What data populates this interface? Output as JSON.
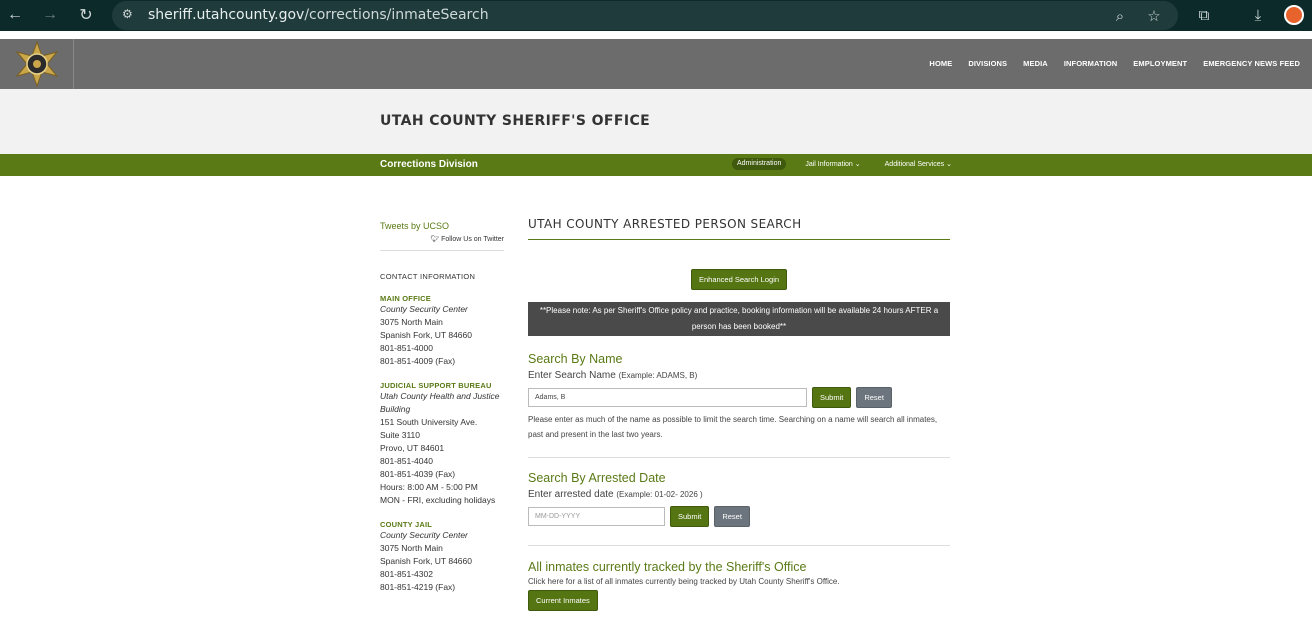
{
  "browser": {
    "url_domain": "sheriff.utahcounty.gov",
    "url_path": "/corrections/inmateSearch"
  },
  "header": {
    "nav": [
      "HOME",
      "DIVISIONS",
      "MEDIA",
      "INFORMATION",
      "EMPLOYMENT",
      "EMERGENCY NEWS FEED"
    ]
  },
  "banner": {
    "title": "UTAH COUNTY SHERIFF'S OFFICE"
  },
  "subbar": {
    "division": "Corrections Division",
    "items": [
      "Administration",
      "Jail Information ⌄",
      "Additional Services ⌄"
    ]
  },
  "sidebar": {
    "tweets": "Tweets by UCSO",
    "follow": "Follow Us on Twitter",
    "contact_heading": "CONTACT INFORMATION",
    "main_office": {
      "heading": "MAIN OFFICE",
      "name": "County Security Center",
      "lines": [
        "3075 North Main",
        "Spanish Fork, UT 84660",
        "801-851-4000",
        "801-851-4009 (Fax)"
      ]
    },
    "judicial": {
      "heading": "JUDICIAL SUPPORT BUREAU",
      "name": "Utah County Health and Justice Building",
      "lines": [
        "151 South University Ave.",
        "Suite 3110",
        "Provo, UT 84601",
        "801-851-4040",
        "801-851-4039 (Fax)",
        "Hours: 8:00 AM - 5:00 PM",
        "MON - FRI, excluding holidays"
      ]
    },
    "jail": {
      "heading": "COUNTY JAIL",
      "name": "County Security Center",
      "lines": [
        "3075 North Main",
        "Spanish Fork, UT 84660",
        "801-851-4302",
        "801-851-4219 (Fax)"
      ]
    }
  },
  "main": {
    "title": "UTAH COUNTY ARRESTED PERSON SEARCH",
    "enhanced_login": "Enhanced Search Login",
    "notice": "**Please note: As per Sheriff's Office policy and practice, booking information will be available 24 hours AFTER a person has been booked**",
    "name_search": {
      "heading": "Search By Name",
      "label": "Enter Search Name",
      "example": "(Example: ADAMS, B)",
      "value": "Adams, B",
      "submit": "Submit",
      "reset": "Reset",
      "help": "Please enter as much of the name as possible to limit the search time. Searching on a name will search all inmates, past and present in the last two years."
    },
    "date_search": {
      "heading": "Search By Arrested Date",
      "label": "Enter arrested date",
      "example": "(Example: 01-02- 2026 )",
      "placeholder": "MM-DD-YYYY",
      "submit": "Submit",
      "reset": "Reset"
    },
    "current": {
      "heading": "All inmates currently tracked by the Sheriff's Office",
      "text": "Click here for a list of all inmates currently being tracked by Utah County Sheriff's Office.",
      "button": "Current Inmates"
    }
  }
}
